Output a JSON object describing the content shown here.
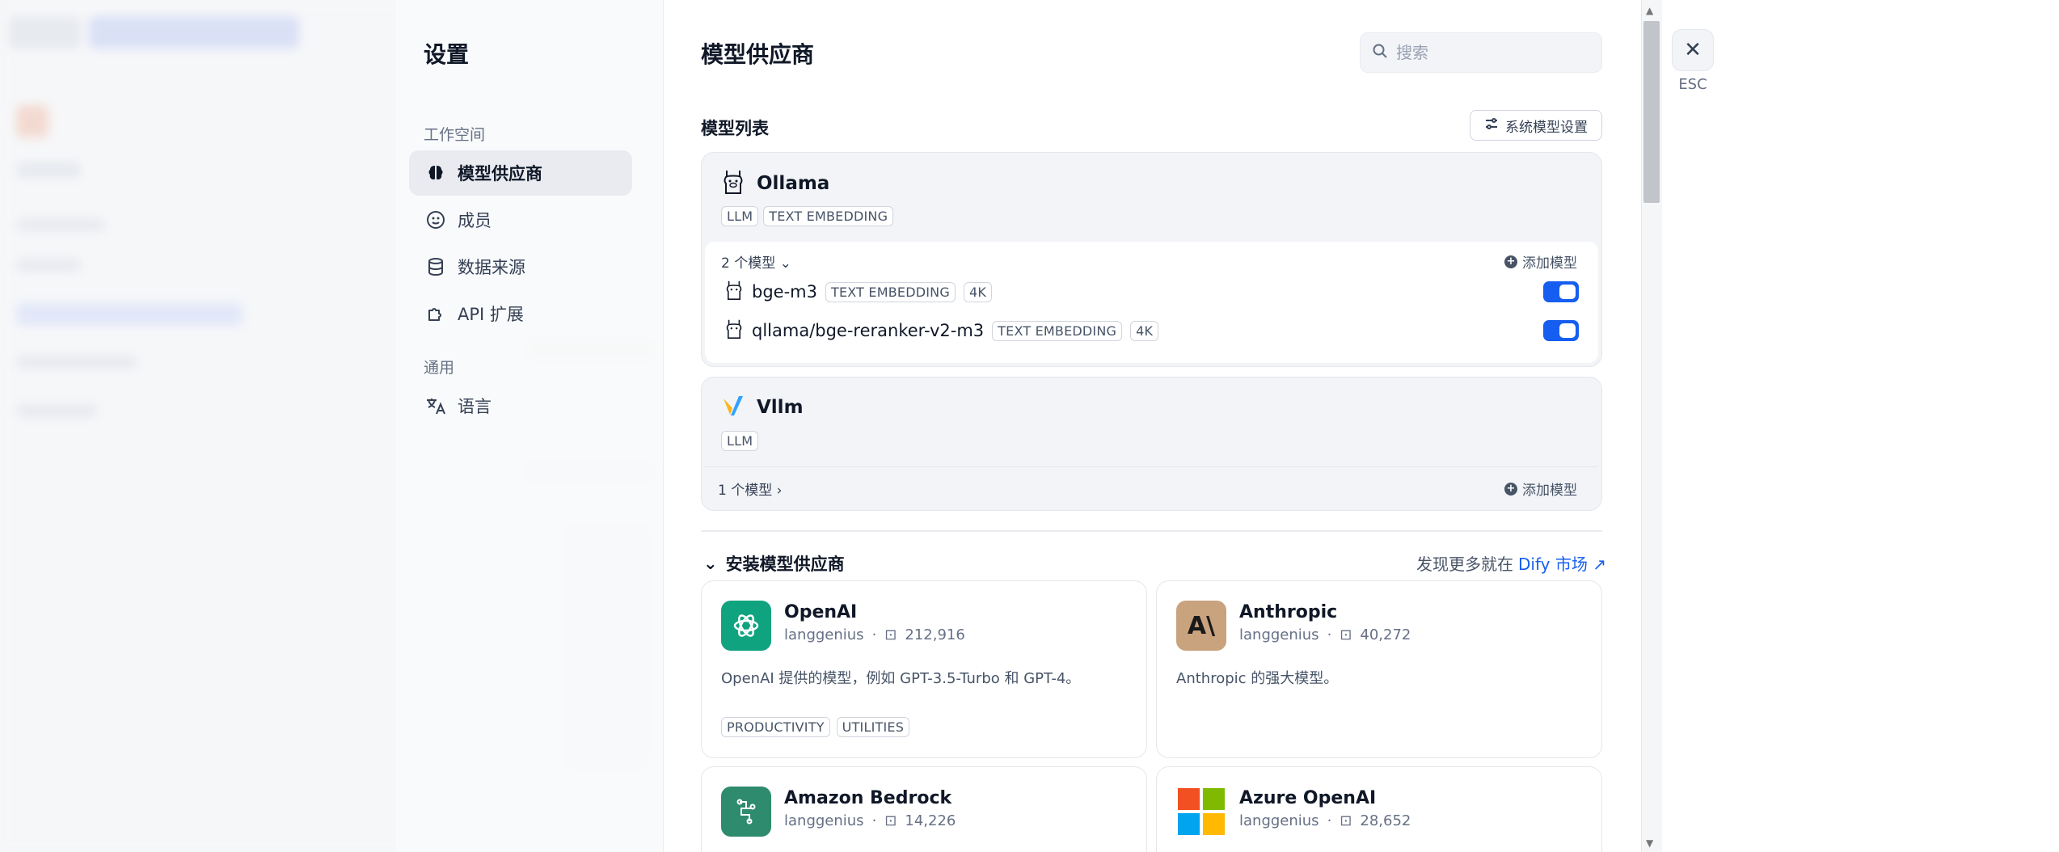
{
  "sidebar": {
    "title": "设置",
    "workspace_label": "工作空间",
    "general_label": "通用",
    "items": [
      {
        "label": "模型供应商"
      },
      {
        "label": "成员"
      },
      {
        "label": "数据来源"
      },
      {
        "label": "API 扩展"
      },
      {
        "label": "语言"
      }
    ]
  },
  "close": {
    "icon": "✕",
    "esc": "ESC"
  },
  "main": {
    "title": "模型供应商",
    "search_placeholder": "搜索",
    "model_list_title": "模型列表",
    "system_settings_label": "系统模型设置",
    "providers": [
      {
        "name": "Ollama",
        "tags": [
          "LLM",
          "TEXT EMBEDDING"
        ],
        "count_label": "2 个模型",
        "add_label": "添加模型",
        "models": [
          {
            "name": "bge-m3",
            "tags": [
              "TEXT EMBEDDING",
              "4K"
            ],
            "enabled": true
          },
          {
            "name": "qllama/bge-reranker-v2-m3",
            "tags": [
              "TEXT EMBEDDING",
              "4K"
            ],
            "enabled": true
          }
        ]
      },
      {
        "name": "Vllm",
        "tags": [
          "LLM"
        ],
        "count_label": "1 个模型",
        "add_label": "添加模型"
      }
    ],
    "install_title": "安装模型供应商",
    "discover_prefix": "发现更多就在",
    "discover_link": "Dify 市场",
    "plugins": [
      {
        "name": "OpenAI",
        "author": "langgenius",
        "installs": "212,916",
        "desc": "OpenAI 提供的模型，例如 GPT-3.5-Turbo 和 GPT-4。",
        "tags": [
          "PRODUCTIVITY",
          "UTILITIES"
        ],
        "color": "#10a37f"
      },
      {
        "name": "Anthropic",
        "author": "langgenius",
        "installs": "40,272",
        "desc": "Anthropic 的强大模型。",
        "tags": [],
        "color": "#c9a27e",
        "logo_text": "A\\"
      },
      {
        "name": "Amazon Bedrock",
        "author": "langgenius",
        "installs": "14,226",
        "desc": "",
        "tags": [],
        "color": "#2e8b6d"
      },
      {
        "name": "Azure OpenAI",
        "author": "langgenius",
        "installs": "28,652",
        "desc": "",
        "tags": [],
        "color": "#ffffff"
      }
    ]
  },
  "colors": {
    "accent": "#155eef",
    "toggle_on": "#155eef"
  }
}
